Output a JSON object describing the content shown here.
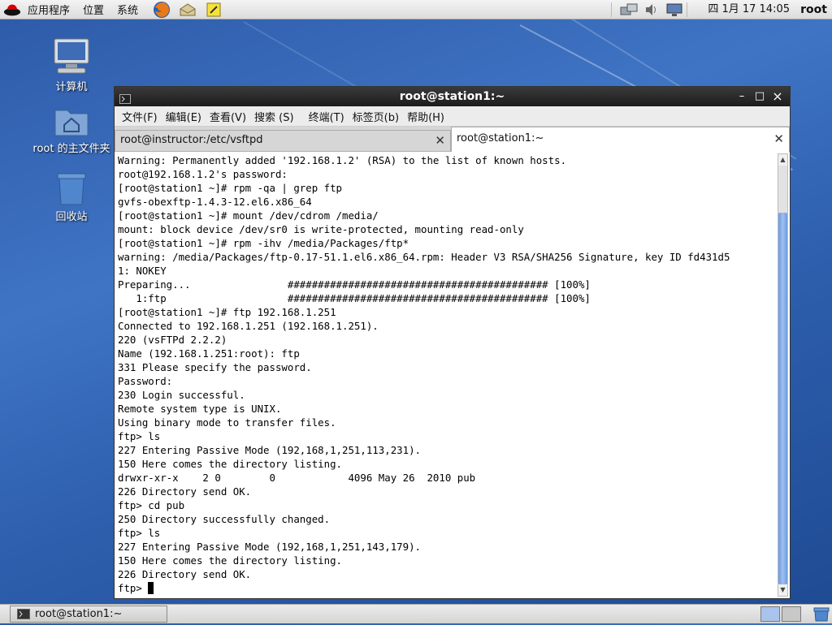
{
  "top_panel": {
    "menus": [
      "应用程序",
      "位置",
      "系统"
    ],
    "launchers": [
      "firefox-icon",
      "mail-icon",
      "notes-icon"
    ],
    "tray_icons": [
      "network-icon",
      "volume-icon",
      "display-icon"
    ],
    "clock": "四 1月 17 14:05",
    "user": "root"
  },
  "desktop": {
    "icons": [
      {
        "label": "计算机",
        "icon": "computer-icon"
      },
      {
        "label": "root 的主文件夹",
        "icon": "home-folder-icon"
      },
      {
        "label": "回收站",
        "icon": "trash-icon"
      }
    ]
  },
  "window": {
    "title": "root@station1:~",
    "controls": {
      "minimize": "–",
      "maximize": "□",
      "close": "×"
    },
    "menus": [
      "文件(F)",
      "编辑(E)",
      "查看(V)",
      "搜索 (S)",
      "终端(T)",
      "标签页(b)",
      "帮助(H)"
    ],
    "tabs": [
      {
        "label": "root@instructor:/etc/vsftpd",
        "active": false
      },
      {
        "label": "root@station1:~",
        "active": true
      }
    ],
    "terminal_lines": [
      "Warning: Permanently added '192.168.1.2' (RSA) to the list of known hosts.",
      "root@192.168.1.2's password:",
      "[root@station1 ~]# rpm -qa | grep ftp",
      "gvfs-obexftp-1.4.3-12.el6.x86_64",
      "[root@station1 ~]# mount /dev/cdrom /media/",
      "mount: block device /dev/sr0 is write-protected, mounting read-only",
      "[root@station1 ~]# rpm -ihv /media/Packages/ftp*",
      "warning: /media/Packages/ftp-0.17-51.1.el6.x86_64.rpm: Header V3 RSA/SHA256 Signature, key ID fd431d5",
      "1: NOKEY",
      "Preparing...                ########################################### [100%]",
      "   1:ftp                    ########################################### [100%]",
      "[root@station1 ~]# ftp 192.168.1.251",
      "Connected to 192.168.1.251 (192.168.1.251).",
      "220 (vsFTPd 2.2.2)",
      "Name (192.168.1.251:root): ftp",
      "331 Please specify the password.",
      "Password:",
      "230 Login successful.",
      "Remote system type is UNIX.",
      "Using binary mode to transfer files.",
      "ftp> ls",
      "227 Entering Passive Mode (192,168,1,251,113,231).",
      "150 Here comes the directory listing.",
      "drwxr-xr-x    2 0        0            4096 May 26  2010 pub",
      "226 Directory send OK.",
      "ftp> cd pub",
      "250 Directory successfully changed.",
      "ftp> ls",
      "227 Entering Passive Mode (192,168,1,251,143,179).",
      "150 Here comes the directory listing.",
      "226 Directory send OK."
    ],
    "prompt": "ftp> "
  },
  "taskbar": {
    "task_label": "root@station1:~"
  },
  "colors": {
    "desktop_blue": "#2d5aa8",
    "titlebar_dark": "#1c1c1c",
    "scroll_thumb": "#6c9be0"
  }
}
